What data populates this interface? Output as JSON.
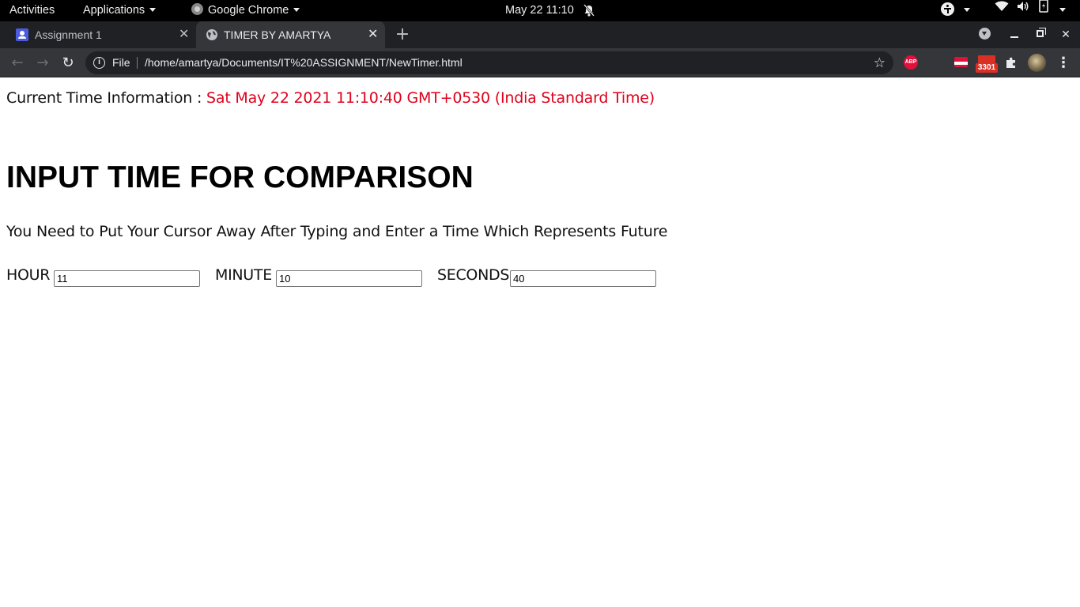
{
  "topbar": {
    "activities": "Activities",
    "applications": "Applications",
    "app_name": "Google Chrome",
    "clock": "May 22  11:10"
  },
  "tabs": [
    {
      "title": "Assignment 1",
      "active": false
    },
    {
      "title": "TIMER BY AMARTYA",
      "active": true
    }
  ],
  "omnibox": {
    "scheme_label": "File",
    "url": "/home/amartya/Documents/IT%20ASSIGNMENT/NewTimer.html"
  },
  "extensions": {
    "abp_label": "ABP",
    "mail_badge": "3301"
  },
  "page": {
    "current_label": "Current Time Information : ",
    "current_time": "Sat May 22 2021 11:10:40 GMT+0530 (India Standard Time)",
    "heading": "INPUT TIME FOR COMPARISON",
    "instruction": "You Need to Put Your Cursor Away After Typing and Enter a Time Which Represents Future",
    "fields": {
      "hour": {
        "label": "HOUR",
        "value": "11"
      },
      "minute": {
        "label": "MINUTE",
        "value": "10"
      },
      "seconds": {
        "label": "SECONDS",
        "value": "40"
      }
    }
  },
  "colors": {
    "time_text": "#e0001b",
    "tab_strip": "#202124",
    "toolbar": "#35363a"
  }
}
